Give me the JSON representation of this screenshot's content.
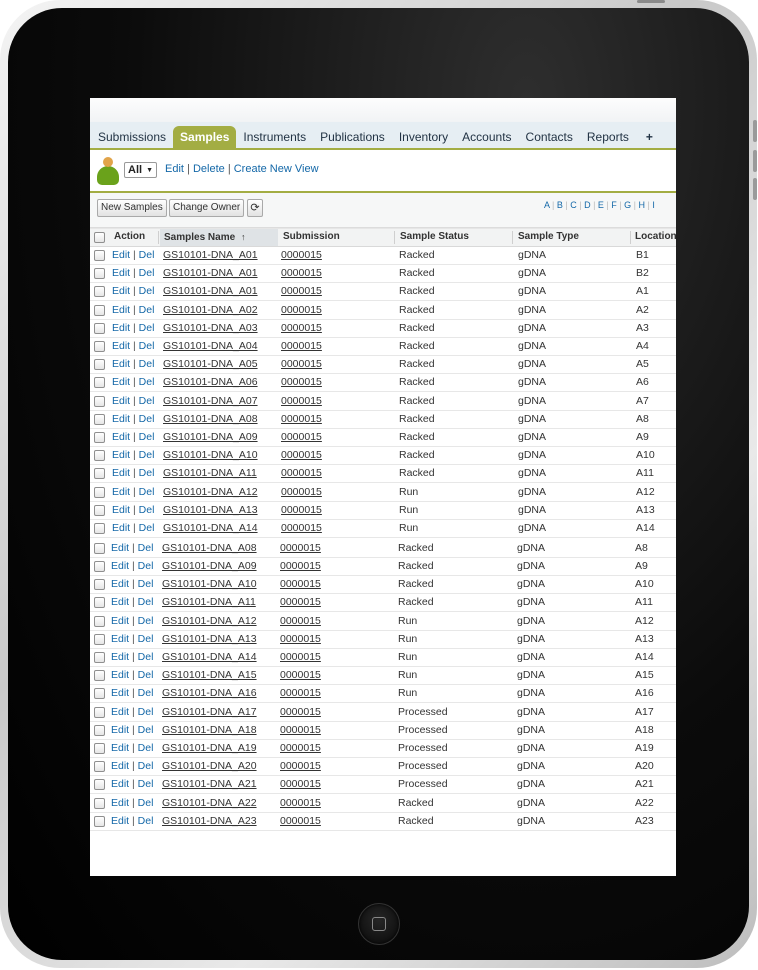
{
  "tabs": [
    "Submissions",
    "Samples",
    "Instruments",
    "Publications",
    "Inventory",
    "Accounts",
    "Contacts",
    "Reports",
    "+"
  ],
  "active_tab": "Samples",
  "view": {
    "selected": "All",
    "edit": "Edit",
    "delete": "Delete",
    "create": "Create New View",
    "separator": "|"
  },
  "toolbar": {
    "new_samples": "New Samples",
    "change_owner": "Change Owner",
    "refresh_glyph": "⟳"
  },
  "alpha_letters": [
    "A",
    "B",
    "C",
    "D",
    "E",
    "F",
    "G",
    "H",
    "I"
  ],
  "columns": {
    "action": "Action",
    "name": "Samples Name",
    "sort_indicator": "↑",
    "submission": "Submission",
    "status": "Sample Status",
    "type": "Sample Type",
    "location": "Location"
  },
  "row_action": {
    "edit": "Edit",
    "sep": " | ",
    "del": "Del"
  },
  "rows": [
    {
      "name": "GS10101-DNA_A01",
      "submission": "0000015",
      "status": "Racked",
      "type": "gDNA",
      "location": "B1"
    },
    {
      "name": "GS10101-DNA_A01",
      "submission": "0000015",
      "status": "Racked",
      "type": "gDNA",
      "location": "B2"
    },
    {
      "name": "GS10101-DNA_A01",
      "submission": "0000015",
      "status": "Racked",
      "type": "gDNA",
      "location": "A1"
    },
    {
      "name": "GS10101-DNA_A02",
      "submission": "0000015",
      "status": "Racked",
      "type": "gDNA",
      "location": "A2"
    },
    {
      "name": "GS10101-DNA_A03",
      "submission": "0000015",
      "status": "Racked",
      "type": "gDNA",
      "location": "A3"
    },
    {
      "name": "GS10101-DNA_A04",
      "submission": "0000015",
      "status": "Racked",
      "type": "gDNA",
      "location": "A4"
    },
    {
      "name": "GS10101-DNA_A05",
      "submission": "0000015",
      "status": "Racked",
      "type": "gDNA",
      "location": "A5"
    },
    {
      "name": "GS10101-DNA_A06",
      "submission": "0000015",
      "status": "Racked",
      "type": "gDNA",
      "location": "A6"
    },
    {
      "name": "GS10101-DNA_A07",
      "submission": "0000015",
      "status": "Racked",
      "type": "gDNA",
      "location": "A7"
    },
    {
      "name": "GS10101-DNA_A08",
      "submission": "0000015",
      "status": "Racked",
      "type": "gDNA",
      "location": "A8"
    },
    {
      "name": "GS10101-DNA_A09",
      "submission": "0000015",
      "status": "Racked",
      "type": "gDNA",
      "location": "A9"
    },
    {
      "name": "GS10101-DNA_A10",
      "submission": "0000015",
      "status": "Racked",
      "type": "gDNA",
      "location": "A10"
    },
    {
      "name": "GS10101-DNA_A11",
      "submission": "0000015",
      "status": "Racked",
      "type": "gDNA",
      "location": "A11"
    },
    {
      "name": "GS10101-DNA_A12",
      "submission": "0000015",
      "status": "Run",
      "type": "gDNA",
      "location": "A12"
    },
    {
      "name": "GS10101-DNA_A13",
      "submission": "0000015",
      "status": "Run",
      "type": "gDNA",
      "location": "A13"
    },
    {
      "name": "GS10101-DNA_A14",
      "submission": "0000015",
      "status": "Run",
      "type": "gDNA",
      "location": "A14"
    },
    {
      "name": "GS10101-DNA_A08",
      "submission": "0000015",
      "status": "Racked",
      "type": "gDNA",
      "location": "A8"
    },
    {
      "name": "GS10101-DNA_A09",
      "submission": "0000015",
      "status": "Racked",
      "type": "gDNA",
      "location": "A9"
    },
    {
      "name": "GS10101-DNA_A10",
      "submission": "0000015",
      "status": "Racked",
      "type": "gDNA",
      "location": "A10"
    },
    {
      "name": "GS10101-DNA_A11",
      "submission": "0000015",
      "status": "Racked",
      "type": "gDNA",
      "location": "A11"
    },
    {
      "name": "GS10101-DNA_A12",
      "submission": "0000015",
      "status": "Run",
      "type": "gDNA",
      "location": "A12"
    },
    {
      "name": "GS10101-DNA_A13",
      "submission": "0000015",
      "status": "Run",
      "type": "gDNA",
      "location": "A13"
    },
    {
      "name": "GS10101-DNA_A14",
      "submission": "0000015",
      "status": "Run",
      "type": "gDNA",
      "location": "A14"
    },
    {
      "name": "GS10101-DNA_A15",
      "submission": "0000015",
      "status": "Run",
      "type": "gDNA",
      "location": "A15"
    },
    {
      "name": "GS10101-DNA_A16",
      "submission": "0000015",
      "status": "Run",
      "type": "gDNA",
      "location": "A16"
    },
    {
      "name": "GS10101-DNA_A17",
      "submission": "0000015",
      "status": "Processed",
      "type": "gDNA",
      "location": "A17"
    },
    {
      "name": "GS10101-DNA_A18",
      "submission": "0000015",
      "status": "Processed",
      "type": "gDNA",
      "location": "A18"
    },
    {
      "name": "GS10101-DNA_A19",
      "submission": "0000015",
      "status": "Processed",
      "type": "gDNA",
      "location": "A19"
    },
    {
      "name": "GS10101-DNA_A20",
      "submission": "0000015",
      "status": "Processed",
      "type": "gDNA",
      "location": "A20"
    },
    {
      "name": "GS10101-DNA_A21",
      "submission": "0000015",
      "status": "Processed",
      "type": "gDNA",
      "location": "A21"
    },
    {
      "name": "GS10101-DNA_A22",
      "submission": "0000015",
      "status": "Racked",
      "type": "gDNA",
      "location": "A22"
    },
    {
      "name": "GS10101-DNA_A23",
      "submission": "0000015",
      "status": "Racked",
      "type": "gDNA",
      "location": "A23"
    }
  ]
}
